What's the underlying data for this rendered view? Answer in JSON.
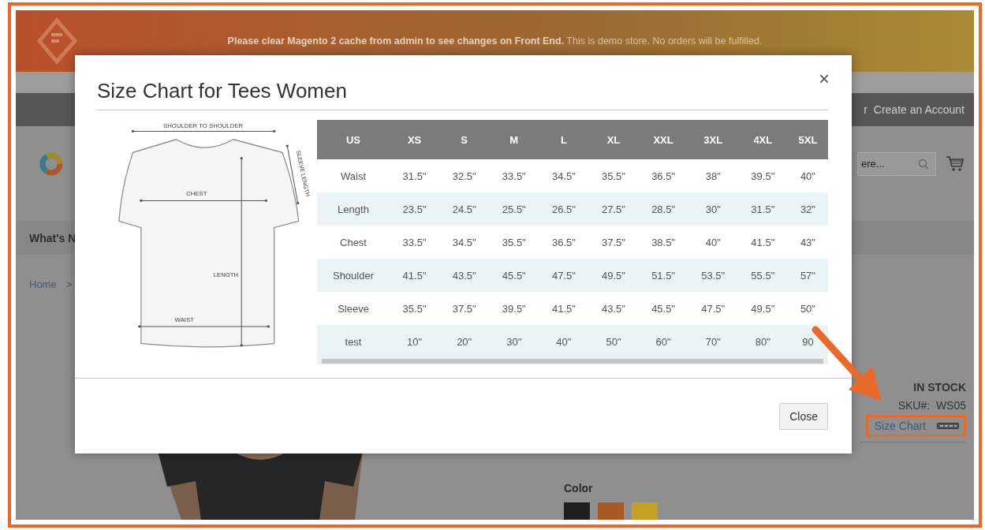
{
  "notice": {
    "text": "**Please clear Magento 2 cache from admin to see changes on Front End.** This is demo store. No orders will be fulfilled."
  },
  "top_links": [
    "r",
    "Create an Account"
  ],
  "search": {
    "placeholder": "ere..."
  },
  "nav": {
    "items": [
      "What's N"
    ]
  },
  "breadcrumb": [
    "Home",
    ">"
  ],
  "product": {
    "stock": "IN STOCK",
    "sku_label": "SKU#:",
    "sku": "WS05",
    "size_chart_link": "Size Chart",
    "highlighted": true
  },
  "color": {
    "label": "Color",
    "swatches": [
      {
        "color": "#1f1f1f"
      },
      {
        "color": "#a85a22"
      },
      {
        "color": "#c2a022"
      }
    ]
  },
  "modal": {
    "title": "Size Chart for Tees Women",
    "close_icon": "×",
    "diagram_labels": {
      "shoulder": "SHOULDER TO SHOULDER",
      "chest": "CHEST",
      "sleeve": "SLEEVE LENGTH",
      "length": "LENGTH",
      "waist": "WAIST"
    },
    "table": {
      "columns": [
        "US",
        "XS",
        "S",
        "M",
        "L",
        "XL",
        "XXL",
        "3XL",
        "4XL",
        "5XL"
      ],
      "rows": [
        [
          "Waist",
          "31.5\"",
          "32.5\"",
          "33.5\"",
          "34.5\"",
          "35.5\"",
          "36.5\"",
          "38\"",
          "39.5\"",
          "40\""
        ],
        [
          "Length",
          "23.5\"",
          "24.5\"",
          "25.5\"",
          "26.5\"",
          "27.5\"",
          "28.5\"",
          "30\"",
          "31.5\"",
          "32\""
        ],
        [
          "Chest",
          "33.5\"",
          "34.5\"",
          "35.5\"",
          "36.5\"",
          "37.5\"",
          "38.5\"",
          "40\"",
          "41.5\"",
          "43\""
        ],
        [
          "Shoulder",
          "41.5\"",
          "43.5\"",
          "45.5\"",
          "47.5\"",
          "49.5\"",
          "51.5\"",
          "53.5\"",
          "55.5\"",
          "57\""
        ],
        [
          "Sleeve",
          "35.5\"",
          "37.5\"",
          "39.5\"",
          "41.5\"",
          "43.5\"",
          "45.5\"",
          "47.5\"",
          "49.5\"",
          "50\""
        ],
        [
          "test",
          "10\"",
          "20\"",
          "30\"",
          "40\"",
          "50\"",
          "60\"",
          "70\"",
          "80\"",
          "90"
        ]
      ]
    },
    "close_button": "Close"
  }
}
